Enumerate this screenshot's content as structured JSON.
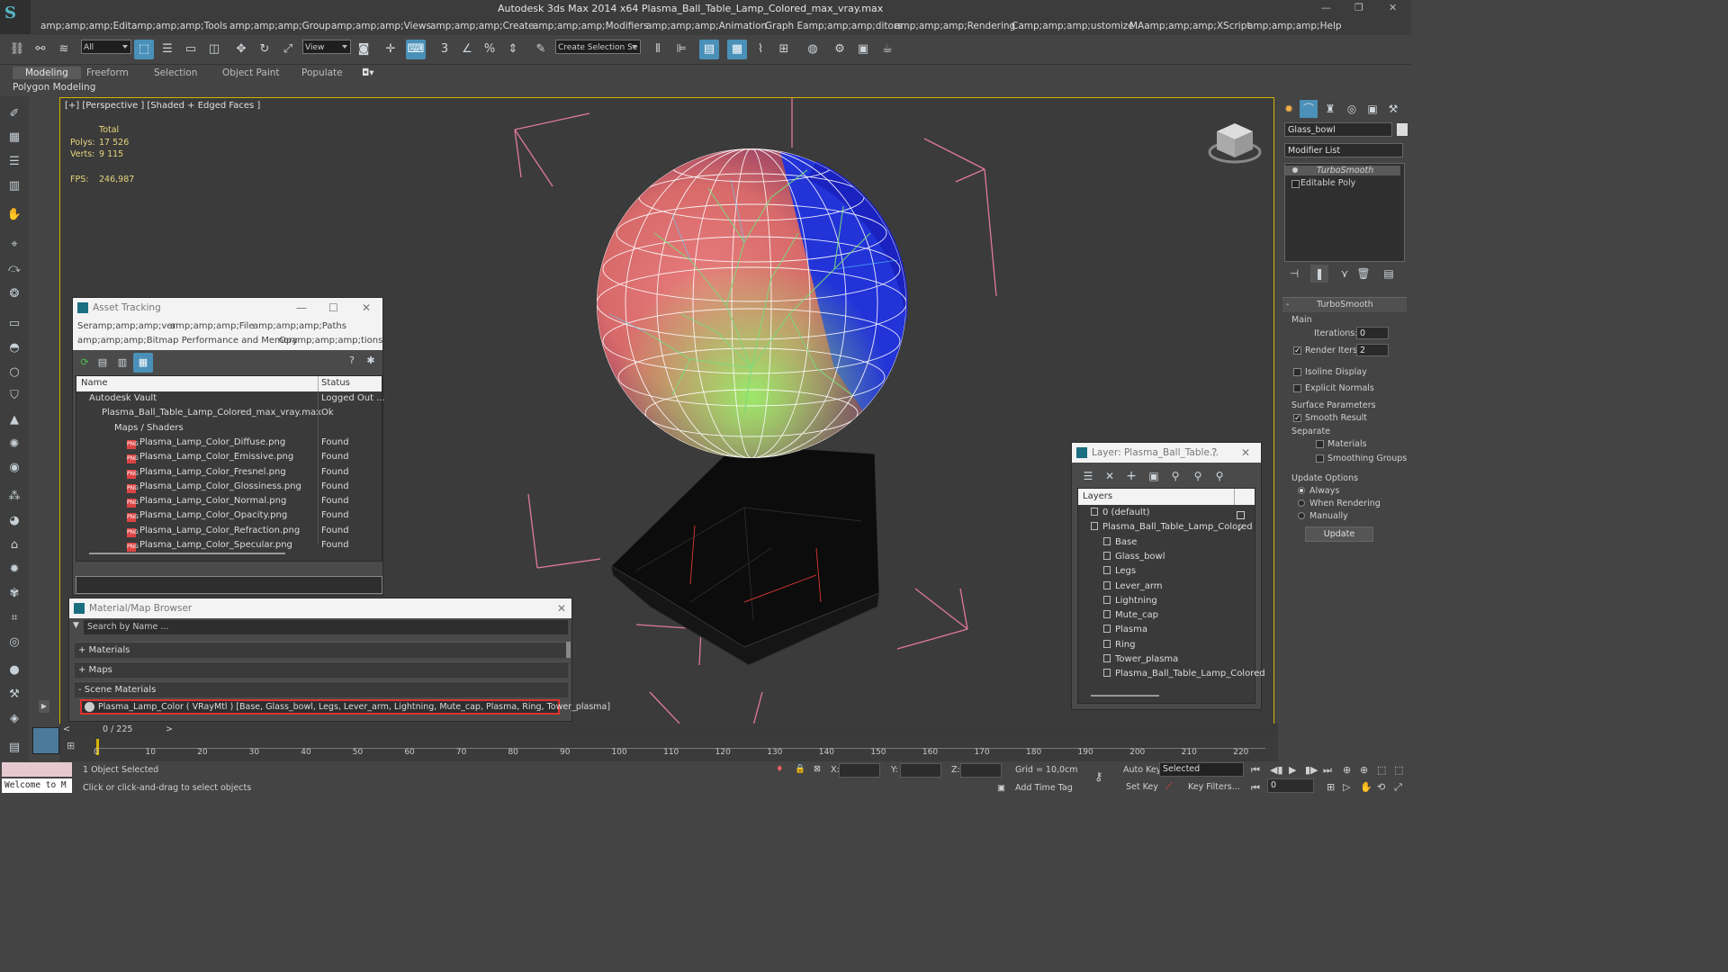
{
  "window": {
    "title": "Autodesk 3ds Max  2014 x64      Plasma_Ball_Table_Lamp_Colored_max_vray.max",
    "controls": [
      "—",
      "❐",
      "✕"
    ]
  },
  "menu": [
    "amp;amp;amp;Edit",
    "amp;amp;amp;Tools",
    "amp;amp;amp;Group",
    "amp;amp;amp;Views",
    "amp;amp;amp;Create",
    "amp;amp;amp;Modifiers",
    "amp;amp;amp;Animation",
    "Graph Eamp;amp;amp;ditors",
    "amp;amp;amp;Rendering",
    "Camp;amp;amp;ustomize",
    "MAamp;amp;amp;XScript",
    "amp;amp;amp;Help"
  ],
  "toolbar": {
    "selection_filter": "All",
    "ref_coord": "View",
    "named_selection": "Create Selection Se"
  },
  "ribbon": {
    "tabs": [
      "Modeling",
      "Freeform",
      "Selection",
      "Object Paint",
      "Populate"
    ],
    "active": "Modeling",
    "sub_label": "Polygon Modeling"
  },
  "viewport": {
    "label": "[+] [Perspective ] [Shaded + Edged Faces ]",
    "stats": {
      "total_label": "Total",
      "polys_label": "Polys:",
      "polys": "17 526",
      "verts_label": "Verts:",
      "verts": "9 115",
      "fps_label": "FPS:",
      "fps": "246,987"
    },
    "colors": {
      "selection_border": "#d8b400",
      "bounding_box": "#e07a99"
    }
  },
  "asset_tracking": {
    "title": "Asset Tracking",
    "menus": [
      "Seramp;amp;amp;ver",
      "amp;amp;amp;File",
      "amp;amp;amp;Paths",
      "amp;amp;amp;Bitmap Performance and Memory",
      "Opamp;amp;amp;tions"
    ],
    "columns": {
      "name": "Name",
      "status": "Status"
    },
    "rows": [
      {
        "name": "Autodesk Vault",
        "status": "Logged Out ..."
      },
      {
        "name": "Plasma_Ball_Table_Lamp_Colored_max_vray.max",
        "status": "Ok"
      },
      {
        "name": "Maps / Shaders",
        "status": ""
      },
      {
        "name": "Plasma_Lamp_Color_Diffuse.png",
        "status": "Found"
      },
      {
        "name": "Plasma_Lamp_Color_Emissive.png",
        "status": "Found"
      },
      {
        "name": "Plasma_Lamp_Color_Fresnel.png",
        "status": "Found"
      },
      {
        "name": "Plasma_Lamp_Color_Glossiness.png",
        "status": "Found"
      },
      {
        "name": "Plasma_Lamp_Color_Normal.png",
        "status": "Found"
      },
      {
        "name": "Plasma_Lamp_Color_Opacity.png",
        "status": "Found"
      },
      {
        "name": "Plasma_Lamp_Color_Refraction.png",
        "status": "Found"
      },
      {
        "name": "Plasma_Lamp_Color_Specular.png",
        "status": "Found"
      }
    ]
  },
  "material_browser": {
    "title": "Material/Map Browser",
    "search_placeholder": "Search by Name ...",
    "groups": [
      "+ Materials",
      "+ Maps",
      "- Scene Materials"
    ],
    "scene_material": "Plasma_Lamp_Color  ( VRayMtl )  [Base, Glass_bowl, Legs, Lever_arm, Lightning, Mute_cap, Plasma, Ring, Tower_plasma]"
  },
  "layer_dialog": {
    "title": "Layer: Plasma_Ball_Table...",
    "help": "?",
    "header": "Layers",
    "layers": [
      {
        "name": "0 (default)",
        "level": 0
      },
      {
        "name": "Plasma_Ball_Table_Lamp_Colored",
        "level": 0
      },
      {
        "name": "Base",
        "level": 1
      },
      {
        "name": "Glass_bowl",
        "level": 1
      },
      {
        "name": "Legs",
        "level": 1
      },
      {
        "name": "Lever_arm",
        "level": 1
      },
      {
        "name": "Lightning",
        "level": 1
      },
      {
        "name": "Mute_cap",
        "level": 1
      },
      {
        "name": "Plasma",
        "level": 1
      },
      {
        "name": "Ring",
        "level": 1
      },
      {
        "name": "Tower_plasma",
        "level": 1
      },
      {
        "name": "Plasma_Ball_Table_Lamp_Colored",
        "level": 1
      }
    ]
  },
  "command_panel": {
    "object_name": "Glass_bowl",
    "modifier_list": "Modifier List",
    "stack": [
      "TurboSmooth",
      "Editable Poly"
    ],
    "rollout_title": "TurboSmooth",
    "main_label": "Main",
    "iterations_label": "Iterations:",
    "iterations": "0",
    "render_iters_label": "Render Iters:",
    "render_iters": "2",
    "isoline": "Isoline Display",
    "explicit_normals": "Explicit Normals",
    "surface_params": "Surface Parameters",
    "smooth_result": "Smooth Result",
    "separate": "Separate",
    "materials": "Materials",
    "smoothing_groups": "Smoothing Groups",
    "update_options": "Update Options",
    "always": "Always",
    "when_rendering": "When Rendering",
    "manually": "Manually",
    "update_button": "Update"
  },
  "timeline": {
    "frame": "0 / 225",
    "ticks": [
      "0",
      "10",
      "20",
      "30",
      "40",
      "50",
      "60",
      "70",
      "80",
      "90",
      "100",
      "110",
      "120",
      "130",
      "140",
      "150",
      "160",
      "170",
      "180",
      "190",
      "200",
      "210",
      "220"
    ]
  },
  "status": {
    "welcome": "Welcome to M",
    "selected": "1 Object Selected",
    "prompt": "Click or click-and-drag to select objects",
    "x_label": "X:",
    "y_label": "Y:",
    "z_label": "Z:",
    "grid": "Grid = 10,0cm",
    "add_time_tag": "Add Time Tag",
    "auto_key": "Auto Key",
    "set_key": "Set Key",
    "key_mode": "Selected",
    "key_filters": "Key Filters...",
    "frame_value": "0"
  }
}
